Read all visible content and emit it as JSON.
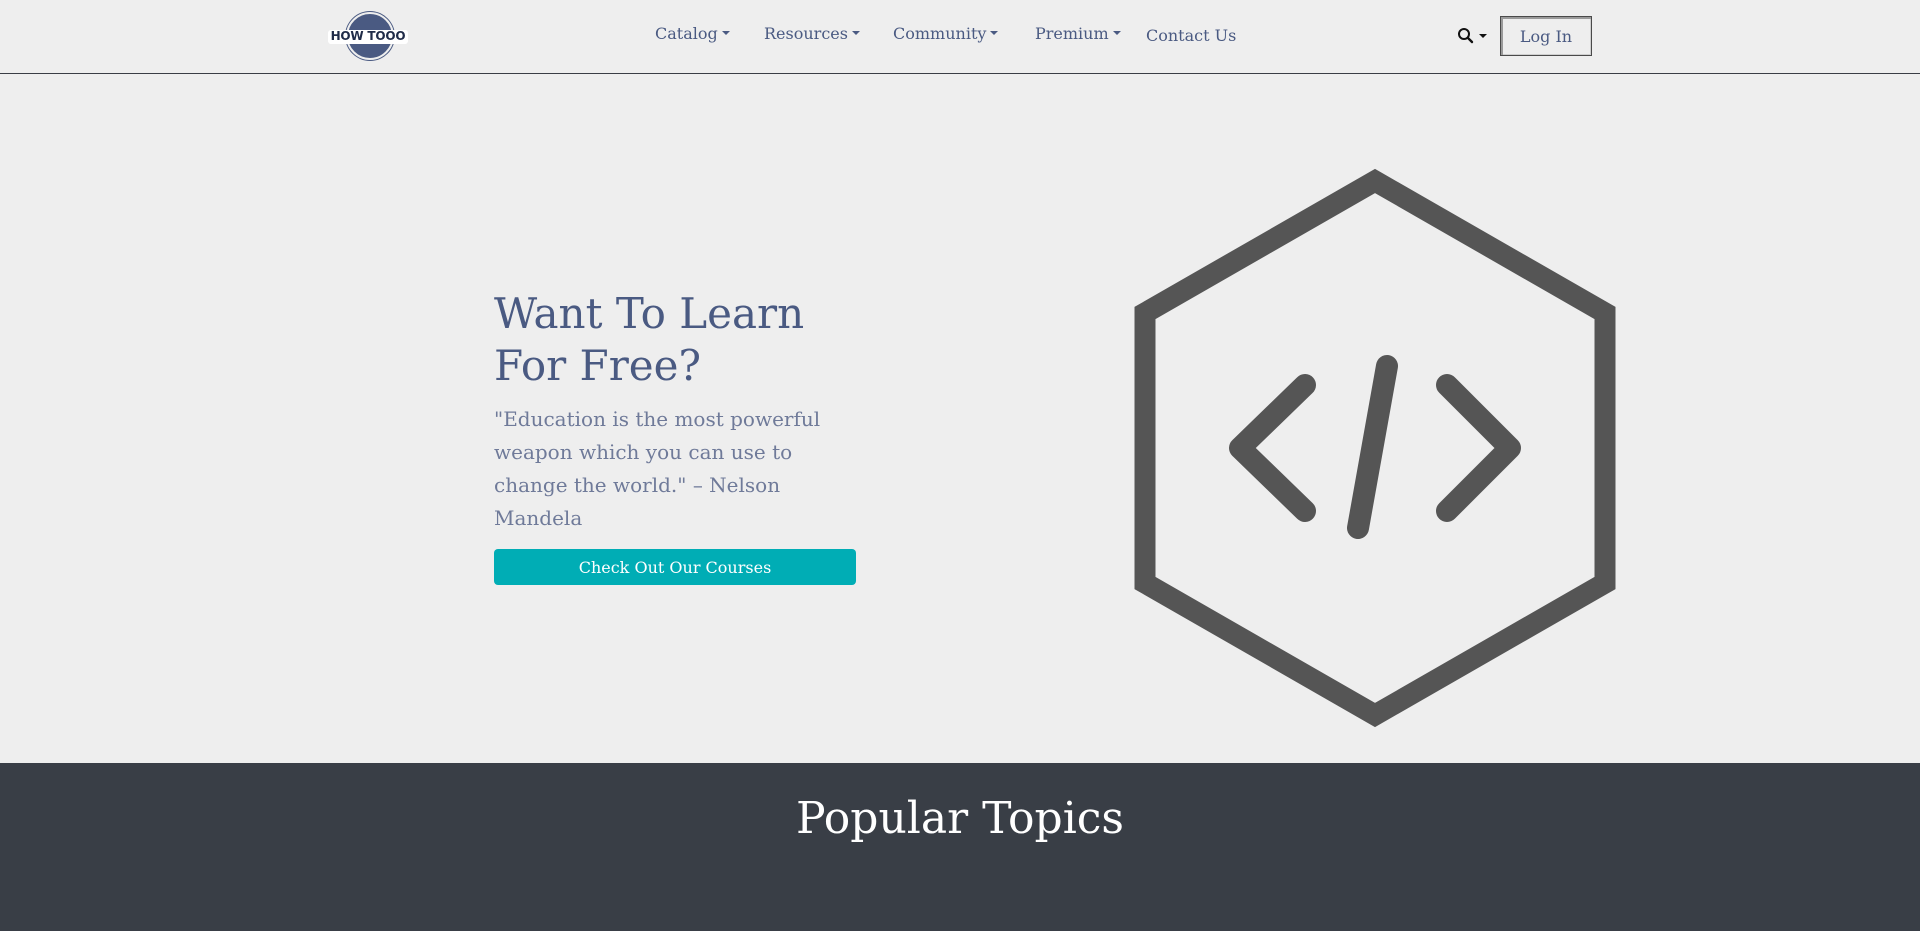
{
  "header": {
    "logo_text": "HOW TOOO",
    "nav": [
      {
        "label": "Catalog"
      },
      {
        "label": "Resources"
      },
      {
        "label": "Community"
      },
      {
        "label": "Premium"
      },
      {
        "label": "Contact Us"
      }
    ],
    "search_icon": "search-icon",
    "login_label": "Log In"
  },
  "hero": {
    "title": "Want To Learn For Free?",
    "quote": "\"Education is the most powerful weapon which you can use to change the world.\" – Nelson Mandela",
    "cta_label": "Check Out Our Courses",
    "graphic_icon": "hexagon-code-icon"
  },
  "topics": {
    "title": "Popular Topics"
  },
  "colors": {
    "background": "#eeeeee",
    "text_primary": "#4a5a82",
    "accent": "#00adb5",
    "dark_section": "#393e46",
    "graphic": "#555555"
  }
}
